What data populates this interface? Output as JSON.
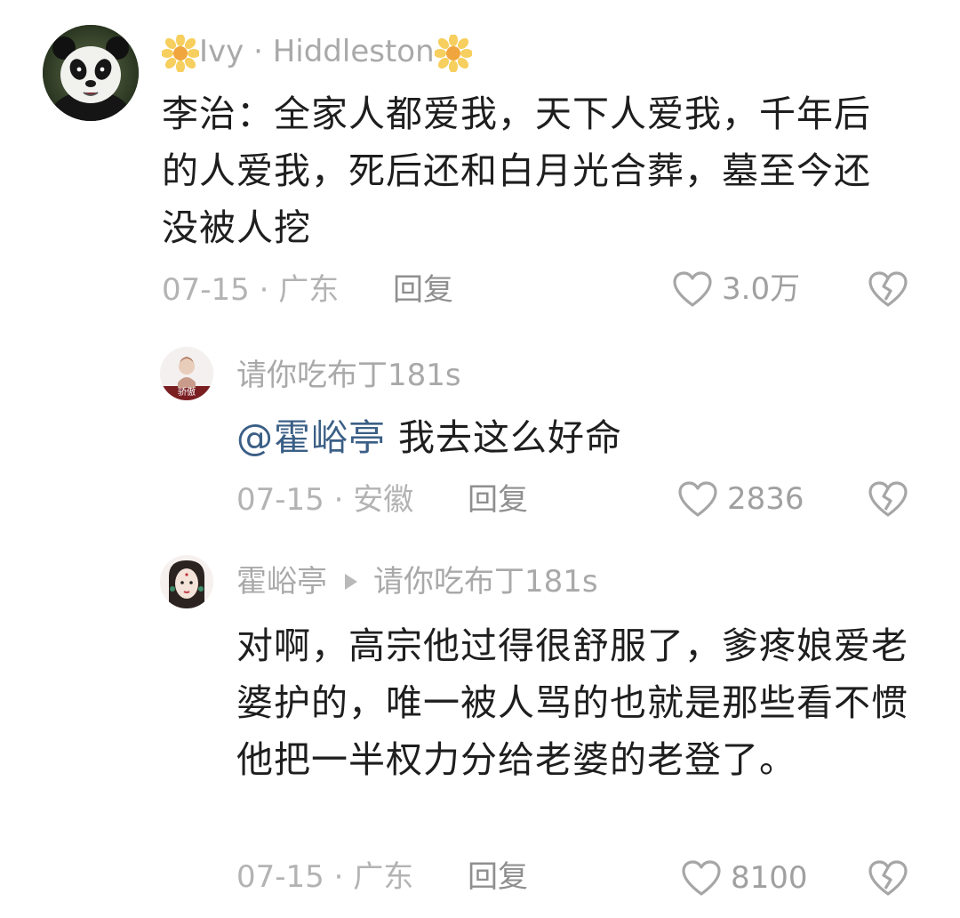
{
  "comments": [
    {
      "username": "Ivy · Hiddleston",
      "text": "李治：全家人都爱我，天下人爱我，千年后的人爱我，死后还和白月光合葬，墓至今还没被人挖",
      "date": "07-15",
      "location": "广东",
      "reply_label": "回复",
      "likes": "3.0万",
      "avatar": "panda-avatar",
      "name_decoration": "sunflower-icon"
    },
    {
      "username": "请你吃布丁181s",
      "mention": "@霍峪亭",
      "text": "我去这么好命",
      "date": "07-15",
      "location": "安徽",
      "reply_label": "回复",
      "likes": "2836",
      "avatar": "doll-avatar",
      "avatar_caption": "骄傲"
    },
    {
      "username": "霍峪亭",
      "reply_to": "请你吃布丁181s",
      "text": "对啊，高宗他过得很舒服了，爹疼娘爱老婆护的，唯一被人骂的也就是那些看不惯他把一半权力分给老婆的老登了。",
      "date": "07-15",
      "location": "广东",
      "reply_label": "回复",
      "likes": "8100",
      "avatar": "illustrated-woman-avatar"
    }
  ],
  "separator": " · ",
  "colors": {
    "meta_gray": "#b3b3b3",
    "mention_blue": "#3b5f86",
    "text": "#1e1e1e"
  }
}
